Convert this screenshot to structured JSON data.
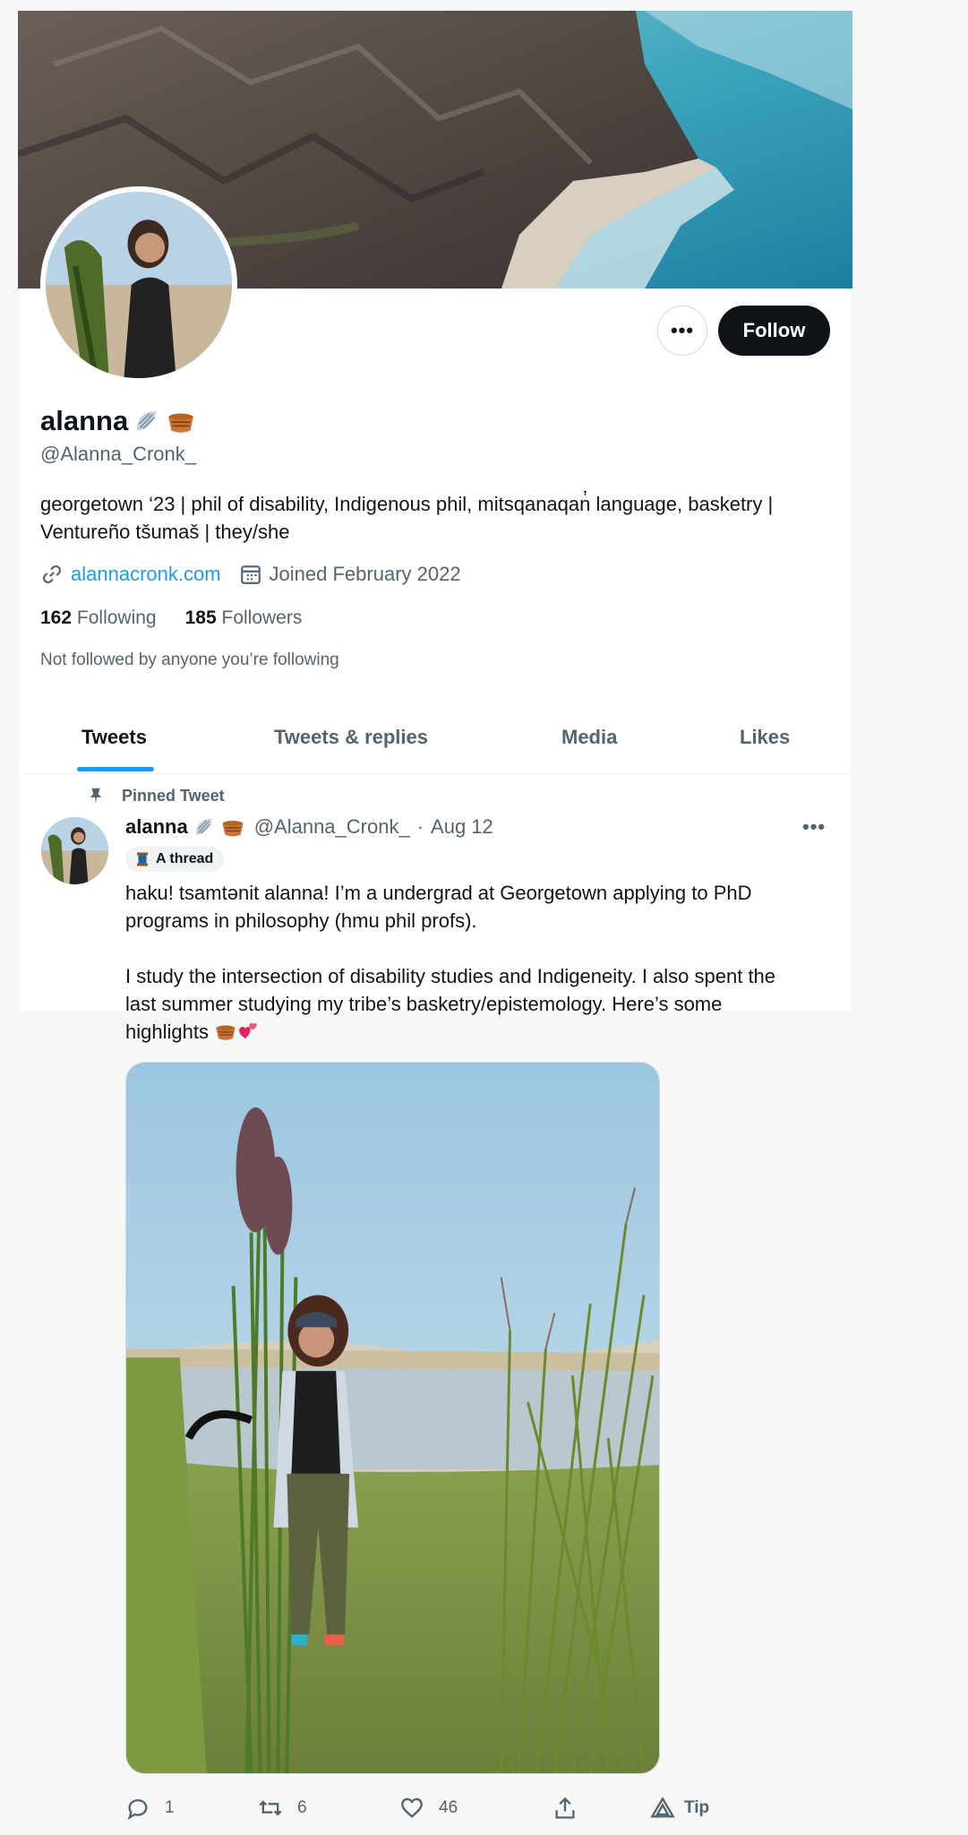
{
  "profile": {
    "name": "alanna",
    "handle": "@Alanna_Cronk_",
    "bio_line1": "georgetown ‘23 | phil of disability, Indigenous phil, mitsqanaqan̓ language, basketry |",
    "bio_line2": "Ventureño tšumaš | they/she",
    "website": "alannacronk.com",
    "joined": "Joined February 2022",
    "following_count": "162",
    "following_label": "Following",
    "followers_count": "185",
    "followers_label": "Followers",
    "not_followed": "Not followed by anyone you’re following",
    "follow_label": "Follow",
    "more_label": "•••"
  },
  "tabs": [
    {
      "label": "Tweets",
      "active": true
    },
    {
      "label": "Tweets & replies",
      "active": false
    },
    {
      "label": "Media",
      "active": false
    },
    {
      "label": "Likes",
      "active": false
    }
  ],
  "tweet": {
    "pinned_label": "Pinned Tweet",
    "author_name": "alanna",
    "author_handle": "@Alanna_Cronk_",
    "separator": "·",
    "date": "Aug 12",
    "more_label": "•••",
    "thread_label": "A thread",
    "text_p1_l1": "haku! tsamtənit alanna! I’m a undergrad at Georgetown applying to PhD",
    "text_p1_l2": "programs in philosophy (hmu phil profs).",
    "text_p2_l1": "I study the intersection of disability studies and Indigeneity. I also spent the",
    "text_p2_l2": "last summer studying my tribe’s basketry/epistemology. Here’s some",
    "text_p2_l3": "highlights",
    "replies": "1",
    "retweets": "6",
    "likes": "46",
    "tip_label": "Tip"
  },
  "icons": {
    "link": "link-icon",
    "calendar": "calendar-icon",
    "pin": "pin-icon",
    "reply": "reply-icon",
    "retweet": "retweet-icon",
    "like": "heart-icon",
    "share": "share-icon",
    "tip": "tip-icon",
    "shell": "shell-emoji",
    "basket": "basket-emoji",
    "heart_emoji": "two-hearts-emoji",
    "thread": "thread-spool-emoji"
  },
  "colors": {
    "accent": "#1d9bf0",
    "text_primary": "#0f1419",
    "text_secondary": "#536471",
    "follow_bg": "#0f1419"
  }
}
